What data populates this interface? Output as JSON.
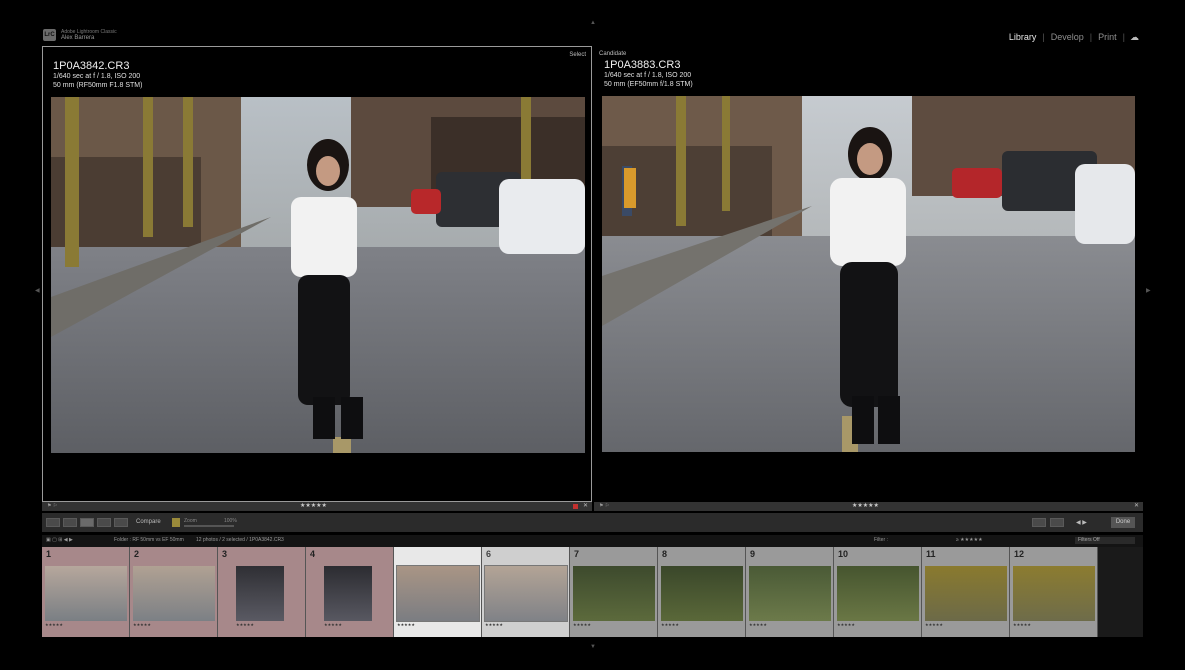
{
  "header": {
    "logo_text": "LrC",
    "app_title": "Adobe Lightroom Classic",
    "user_name": "Alex Barrera",
    "modules": [
      "Library",
      "Develop",
      "Print"
    ],
    "active_module": "Library"
  },
  "compare": {
    "select": {
      "label": "Select",
      "filename": "1P0A3842.CR3",
      "exposure": "1/640 sec at f / 1.8, ISO 200",
      "lens": "50 mm (RF50mm F1.8 STM)",
      "rating": "★★★★★"
    },
    "candidate": {
      "label": "Candidate",
      "filename": "1P0A3883.CR3",
      "exposure": "1/640 sec at f / 1.8, ISO 200",
      "lens": "50 mm (EF50mm f/1.8 STM)",
      "rating": "★★★★★"
    }
  },
  "toolbar": {
    "compare_label": "Compare",
    "zoom_label": "Zoom",
    "zoom_pct": "100%",
    "done_label": "Done"
  },
  "filmstrip_header": {
    "folder_text": "Folder : RF 50mm vs EF 50mm",
    "count_text": "12 photos / 2 selected / 1P0A3842.CR3",
    "filter_label": "Filter :",
    "filters_off": "Filters Off"
  },
  "filmstrip": {
    "cells": [
      {
        "num": "1",
        "stars": "★★★★★"
      },
      {
        "num": "2",
        "stars": "★★★★★"
      },
      {
        "num": "3",
        "stars": "★★★★★"
      },
      {
        "num": "4",
        "stars": "★★★★★"
      },
      {
        "num": "5",
        "stars": "★★★★★"
      },
      {
        "num": "6",
        "stars": "★★★★★"
      },
      {
        "num": "7",
        "stars": "★★★★★"
      },
      {
        "num": "8",
        "stars": "★★★★★"
      },
      {
        "num": "9",
        "stars": "★★★★★"
      },
      {
        "num": "10",
        "stars": "★★★★★"
      },
      {
        "num": "11",
        "stars": "★★★★★"
      },
      {
        "num": "12",
        "stars": "★★★★★"
      }
    ]
  },
  "colors": {
    "background": "#000000",
    "panel_border": "#9a9a9a",
    "pink_label": "#a7888a",
    "gray_label": "#9a9a9a",
    "selected_cell": "#e8e8e8"
  }
}
